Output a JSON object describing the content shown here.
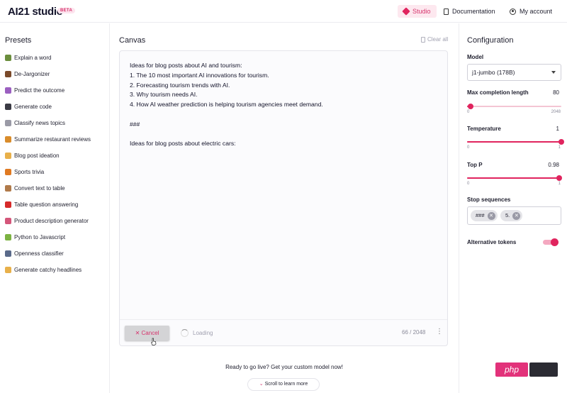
{
  "header": {
    "logo": "AI21 studio",
    "beta": "BETA",
    "nav": [
      {
        "label": "Studio",
        "icon": "cube-icon"
      },
      {
        "label": "Documentation",
        "icon": "document-icon"
      },
      {
        "label": "My account",
        "icon": "user-icon"
      }
    ],
    "accent": "#e0245e"
  },
  "presets": {
    "title": "Presets",
    "items": [
      {
        "label": "Explain a word",
        "icon": "books-emoji",
        "color": "#6b8e3d"
      },
      {
        "label": "De-Jargonizer",
        "icon": "briefcase-emoji",
        "color": "#7a4a2a"
      },
      {
        "label": "Predict the outcome",
        "icon": "crystal-ball-emoji",
        "color": "#9b5fc0"
      },
      {
        "label": "Generate code",
        "icon": "laptop-emoji",
        "color": "#3a3a44"
      },
      {
        "label": "Classify news topics",
        "icon": "newspaper-emoji",
        "color": "#9a9aa6"
      },
      {
        "label": "Summarize restaurant reviews",
        "icon": "burger-emoji",
        "color": "#d98c2b"
      },
      {
        "label": "Blog post ideation",
        "icon": "writing-hand-emoji",
        "color": "#e8b04a"
      },
      {
        "label": "Sports trivia",
        "icon": "basketball-emoji",
        "color": "#e07a22"
      },
      {
        "label": "Convert text to table",
        "icon": "abacus-emoji",
        "color": "#b07a4a"
      },
      {
        "label": "Table question answering",
        "icon": "question-mark-emoji",
        "color": "#d62a2a"
      },
      {
        "label": "Product description generator",
        "icon": "shopping-bag-emoji",
        "color": "#d4567a"
      },
      {
        "label": "Python to Javascript",
        "icon": "snake-emoji",
        "color": "#7cb342"
      },
      {
        "label": "Openness classifier",
        "icon": "speaking-head-emoji",
        "color": "#5a6a8a"
      },
      {
        "label": "Generate catchy headlines",
        "icon": "pencil-emoji",
        "color": "#e8b04a"
      }
    ]
  },
  "canvas": {
    "title": "Canvas",
    "clear_all": "Clear all",
    "text": "Ideas for blog posts about AI and tourism:\n1. The 10 most important AI innovations for tourism.\n2. Forecasting tourism trends with AI.\n3. Why tourism needs AI.\n4. How AI weather prediction is helping tourism agencies meet demand.\n\n###\n\nIdeas for blog posts about electric cars:",
    "cancel": "Cancel",
    "loading": "Loading",
    "counter": "66 / 2048",
    "cta": "Ready to go live? Get your custom model now!",
    "scroll": "Scroll to learn more"
  },
  "config": {
    "title": "Configuration",
    "model_label": "Model",
    "model_value": "j1-jumbo (178B)",
    "max_len": {
      "label": "Max completion length",
      "value": "80",
      "min": "0",
      "max": "2048",
      "fraction": 0.039
    },
    "temperature": {
      "label": "Temperature",
      "value": "1",
      "min": "0",
      "max": "1",
      "fraction": 1.0
    },
    "top_p": {
      "label": "Top P",
      "value": "0.98",
      "min": "0",
      "max": "1",
      "fraction": 0.98
    },
    "stop_label": "Stop sequences",
    "stops": [
      "###",
      "5."
    ],
    "alt_tokens_label": "Alternative tokens",
    "alt_tokens_on": true
  }
}
